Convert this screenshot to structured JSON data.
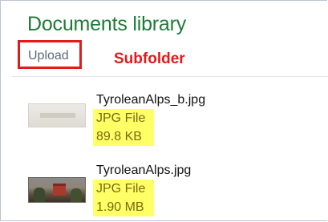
{
  "library": {
    "title": "Documents library",
    "upload_label": "Upload",
    "subfolder_note": "Subfolder"
  },
  "files": [
    {
      "name": "TyroleanAlps_b.jpg",
      "type": "JPG File",
      "size": "89.8 KB",
      "thumbnail": "light-placeholder-thumbnail"
    },
    {
      "name": "TyroleanAlps.jpg",
      "type": "JPG File",
      "size": "1.90 MB",
      "thumbnail": "alpine-castle-photo-thumbnail"
    }
  ],
  "colors": {
    "title": "#1e7a38",
    "annotation_red": "#e11b1b",
    "highlight_yellow": "#ffff66",
    "upload_text": "#5a6b7d"
  }
}
